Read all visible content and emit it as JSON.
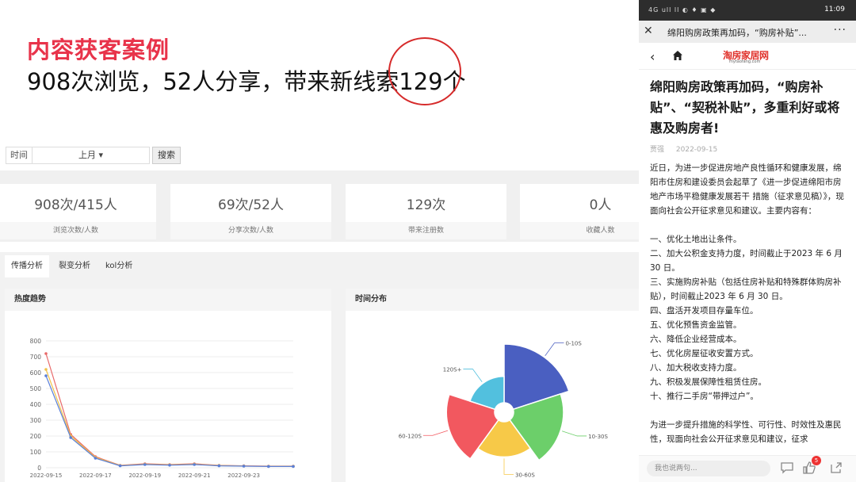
{
  "headline": {
    "title": "内容获客案例",
    "subtitle": "908次浏览，52人分享，带来新线索129个"
  },
  "colors": {
    "accent_red": "#e8334a",
    "circle_red": "#d62a2a"
  },
  "dashboard": {
    "filter": {
      "label": "时间",
      "value": "上月 ▾",
      "button": "搜索"
    },
    "stats": [
      {
        "value": "908次/415人",
        "label": "浏览次数/人数"
      },
      {
        "value": "69次/52人",
        "label": "分享次数/人数"
      },
      {
        "value": "129次",
        "label": "带来注册数"
      },
      {
        "value": "0人",
        "label": "收藏人数"
      }
    ],
    "tabs": [
      "传播分析",
      "裂变分析",
      "kol分析"
    ],
    "active_tab": "传播分析",
    "panels": {
      "trend_title": "热度趋势",
      "time_title": "时间分布"
    }
  },
  "chart_data": [
    {
      "type": "line",
      "title": "热度趋势",
      "x": [
        "2022-09-15",
        "2022-09-16",
        "2022-09-17",
        "2022-09-18",
        "2022-09-19",
        "2022-09-20",
        "2022-09-21",
        "2022-09-22",
        "2022-09-23",
        "2022-09-24",
        "2022-09-25"
      ],
      "x_tick_labels": [
        "2022-09-15",
        "2022-09-17",
        "2022-09-19",
        "2022-09-21",
        "2022-09-23"
      ],
      "ylim": [
        0,
        800
      ],
      "y_ticks": [
        0,
        100,
        200,
        300,
        400,
        500,
        600,
        700,
        800
      ],
      "grid": true,
      "series": [
        {
          "color": "#e86a6a",
          "values": [
            720,
            210,
            70,
            15,
            25,
            20,
            25,
            15,
            12,
            10,
            10
          ]
        },
        {
          "color": "#f0c24a",
          "values": [
            620,
            200,
            65,
            14,
            22,
            18,
            22,
            14,
            11,
            9,
            9
          ]
        },
        {
          "color": "#5a7fd8",
          "values": [
            580,
            190,
            60,
            12,
            20,
            16,
            20,
            12,
            10,
            8,
            8
          ]
        }
      ]
    },
    {
      "type": "pie",
      "title": "时间分布",
      "subtype": "rose",
      "slices": [
        {
          "label": "0-10S",
          "value": 100,
          "color": "#4a5fc1"
        },
        {
          "label": "10-30S",
          "value": 85,
          "color": "#6ccf6a"
        },
        {
          "label": "30-60S",
          "value": 60,
          "color": "#f7c948"
        },
        {
          "label": "60-120S",
          "value": 82,
          "color": "#f2585f"
        },
        {
          "label": "120S+",
          "value": 45,
          "color": "#52c0de"
        }
      ]
    }
  ],
  "phone": {
    "status": {
      "left": "4G ull ll ◐ ♦ ▣ ◆",
      "time": "11:09"
    },
    "wechat": {
      "close": "✕",
      "title": "绵阳购房政策再加码，“购房补贴”...",
      "more": "···"
    },
    "nav": {
      "back": "‹",
      "logo_main": "淘房家居网",
      "logo_sub": "mytaofang.com"
    },
    "article": {
      "title": "绵阳购房政策再加码，“购房补贴”、“契税补贴”，多重利好或将惠及购房者!",
      "author": "贾强",
      "date": "2022-09-15",
      "intro": "近日，为进一步促进房地产良性循环和健康发展，绵阳市住房和建设委员会起草了《进一步促进绵阳市房地产市场平稳健康发展若干 措施（征求意见稿）》，现面向社会公开征求意见和建议。主要内容有：",
      "items": [
        "一、优化土地出让条件。",
        "二、加大公积金支持力度，时间截止于2023 年 6 月 30 日。",
        "三、实施购房补贴（包括住房补贴和特殊群体购房补贴），时间截止2023 年 6 月 30 日。",
        "四、盘活开发项目存量车位。",
        "五、优化预售资金监管。",
        "六、降低企业经营成本。",
        "七、优化房屋征收安置方式。",
        "八、加大税收支持力度。",
        "九、积极发展保障性租赁住房。",
        "十、推行二手房“带押过户”。"
      ],
      "outro": "为进一步提升措施的科学性、可行性、时效性及惠民性，现面向社会公开征求意见和建议，征求"
    },
    "bottom": {
      "comment_placeholder": "我也说两句...",
      "like_count": "5"
    }
  }
}
